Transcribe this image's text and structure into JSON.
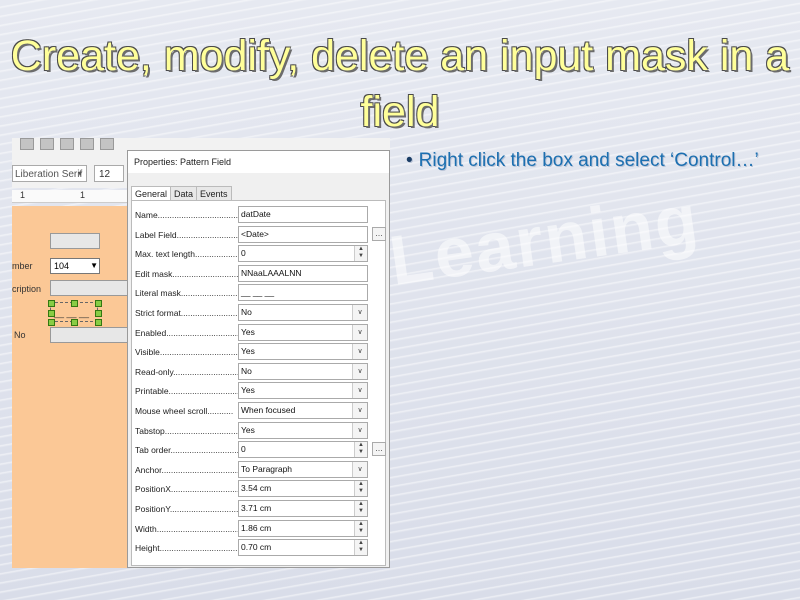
{
  "slide": {
    "title": "Create, modify, delete an input mask in a field",
    "bullet": "Right click the box and select ‘Control…’",
    "watermark": "Learning"
  },
  "toolbar": {
    "font_name": "Liberation Serif",
    "font_size": "12"
  },
  "ruler": {
    "marks": [
      "1",
      "1"
    ]
  },
  "form": {
    "labels": [
      "mber",
      "cription",
      "No"
    ],
    "combo_value": "104",
    "selected_field_text": "__ __ __"
  },
  "dialog": {
    "title": "Properties: Pattern Field",
    "tabs": [
      "General",
      "Data",
      "Events"
    ],
    "properties": [
      {
        "label": "Name....................................",
        "value": "datDate",
        "control": "text"
      },
      {
        "label": "Label Field..........................",
        "value": "<Date>",
        "control": "text-more"
      },
      {
        "label": "Max. text length..................",
        "value": "0",
        "control": "spin"
      },
      {
        "label": "Edit mask............................",
        "value": "NNaaLAAALNN",
        "control": "text"
      },
      {
        "label": "Literal mask..........................",
        "value": "__ __ __",
        "control": "text"
      },
      {
        "label": "Strict format.........................",
        "value": "No",
        "control": "dropdown"
      },
      {
        "label": "Enabled.................................",
        "value": "Yes",
        "control": "dropdown"
      },
      {
        "label": "Visible....................................",
        "value": "Yes",
        "control": "dropdown"
      },
      {
        "label": "Read-only...............................",
        "value": "No",
        "control": "dropdown"
      },
      {
        "label": "Printable.................................",
        "value": "Yes",
        "control": "dropdown"
      },
      {
        "label": "Mouse wheel scroll...........",
        "value": "When focused",
        "control": "dropdown"
      },
      {
        "label": "Tabstop...................................",
        "value": "Yes",
        "control": "dropdown"
      },
      {
        "label": "Tab order...............................",
        "value": "0",
        "control": "spin-more"
      },
      {
        "label": "Anchor....................................",
        "value": "To Paragraph",
        "control": "dropdown"
      },
      {
        "label": "PositionX...............................",
        "value": "3.54 cm",
        "control": "spin"
      },
      {
        "label": "PositionY...............................",
        "value": "3.71 cm",
        "control": "spin"
      },
      {
        "label": "Width.......................................",
        "value": "1.86 cm",
        "control": "spin"
      },
      {
        "label": "Height.....................................",
        "value": "0.70 cm",
        "control": "spin"
      }
    ]
  },
  "colors": {
    "title": "#ffff99",
    "bullet": "#1c6fb0",
    "form_background": "#fbc896"
  }
}
